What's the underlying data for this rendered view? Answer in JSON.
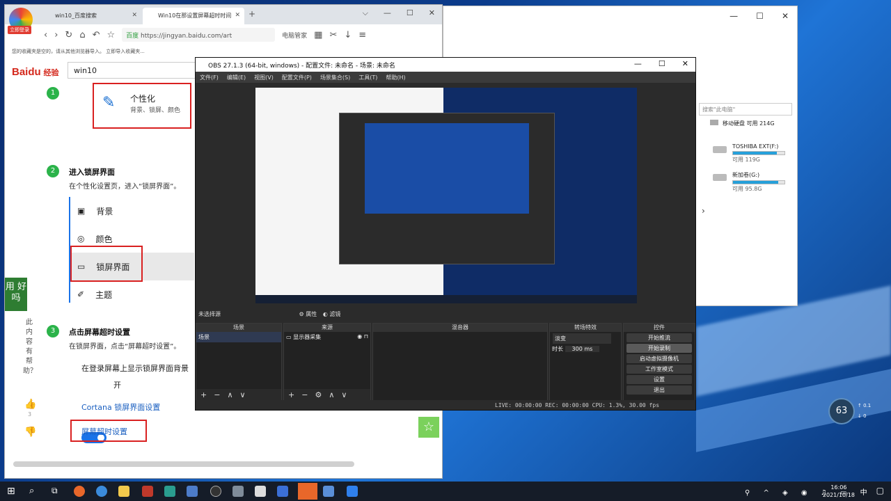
{
  "browser": {
    "tabs": [
      {
        "label": "win10_百度搜索"
      },
      {
        "label": "Win10在那设置屏幕超时时间"
      }
    ],
    "login_badge": "立即登录",
    "url": "https://jingyan.baidu.com/art",
    "url_prefix": "百度",
    "right_nav": "电脑管家",
    "favbar_text": "您的收藏夹是空的，请从其他浏览器导入。 立即导入收藏夹...",
    "logo_text": "Baidu",
    "logo_sub": "经验",
    "search_value": "win10",
    "step1": {
      "num": "1",
      "title": "个性化",
      "desc": "背景、锁屏、颜色"
    },
    "step2": {
      "num": "2",
      "title": "进入锁屏界面",
      "desc": "在个性化设置页，进入“锁屏界面”。"
    },
    "menu": [
      {
        "label": "背景"
      },
      {
        "label": "颜色"
      },
      {
        "label": "锁屏界面"
      },
      {
        "label": "主题"
      }
    ],
    "step3": {
      "num": "3",
      "title": "点击屏幕超时设置",
      "desc": "在锁屏界面，点击“屏幕超时设置”。"
    },
    "lock_option": "在登录屏幕上显示锁屏界面背景",
    "toggle_label": "开",
    "cortana_link": "Cortana 锁屏界面设置",
    "timeout_link": "屏幕超时设置",
    "side_vote": "此内容有帮助？",
    "side_count": "3",
    "avatar_text": "用 好吗",
    "star": "☆"
  },
  "explorer": {
    "search_placeholder": "搜索\"此电脑\"",
    "removable": "移动硬盘 可用 214G",
    "drives": [
      {
        "name": "TOSHIBA EXT(F:)",
        "free": "可用 119G",
        "fill": 0.85
      },
      {
        "name": "新加卷(G:)",
        "free": "可用 95.8G",
        "fill": 0.88
      }
    ]
  },
  "obs": {
    "title": "OBS 27.1.3 (64-bit, windows) - 配置文件: 未命名 - 场景: 未命名",
    "menu": [
      "文件(F)",
      "编辑(E)",
      "视图(V)",
      "配置文件(P)",
      "场景集合(S)",
      "工具(T)",
      "帮助(H)"
    ],
    "no_source": "未选择源",
    "props": "属性",
    "filters": "滤镜",
    "docks": {
      "scenes": {
        "title": "场景",
        "items": [
          "场景"
        ]
      },
      "sources": {
        "title": "来源",
        "items": [
          "显示器采集"
        ]
      },
      "mixer": {
        "title": "混音器"
      },
      "transitions": {
        "title": "转场特效",
        "type": "淡变",
        "duration_label": "时长",
        "duration": "300 ms"
      },
      "controls": {
        "title": "控件",
        "buttons": [
          "开始推流",
          "开始录制",
          "启动虚拟摄像机",
          "工作室模式",
          "设置",
          "退出"
        ]
      }
    },
    "status": "LIVE: 00:00:00   REC: 00:00:00   CPU: 1.3%, 30.00 fps"
  },
  "widget": {
    "percent": "63",
    "up": "0.1",
    "down": "0"
  },
  "taskbar": {
    "time": "16:06",
    "date": "2021/10/18",
    "ime": "中"
  }
}
